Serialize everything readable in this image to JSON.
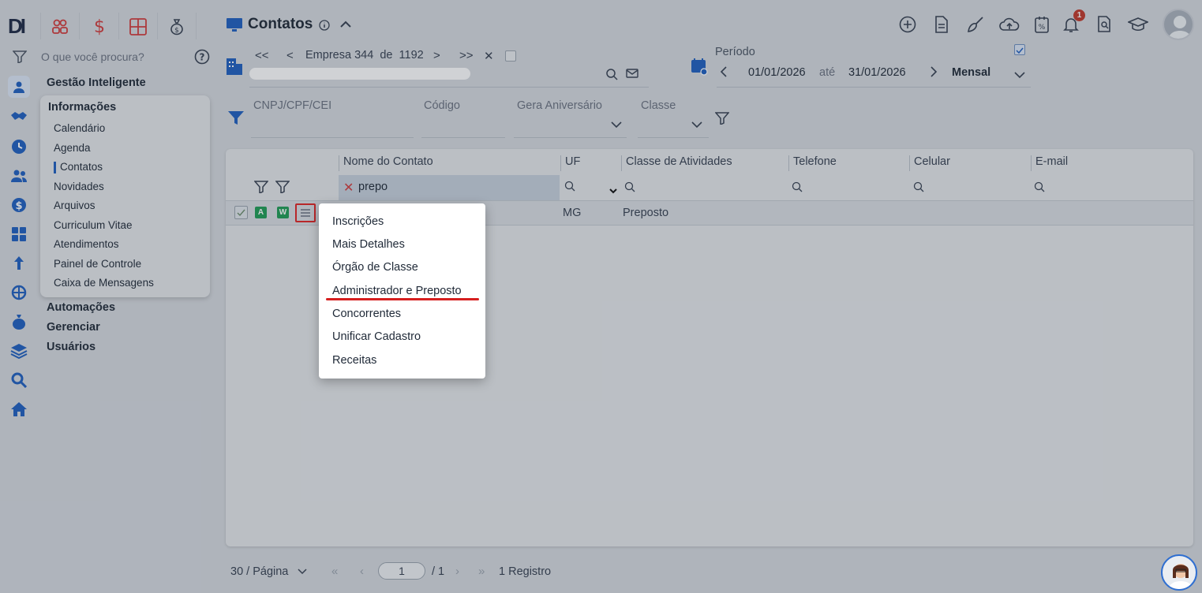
{
  "rail": {
    "logo": "DI",
    "icons": [
      "filter-icon",
      "user-card-icon",
      "handshake-icon",
      "clock-icon",
      "users-icon",
      "dollar-icon",
      "calculator-icon",
      "upload-arrow-icon",
      "globe-network-icon",
      "money-bag-icon",
      "layers-icon",
      "search-icon",
      "home-icon"
    ]
  },
  "top_modules": [
    "people-icon",
    "dollar-icon",
    "calculator-icon",
    "money-bag-icon"
  ],
  "search": {
    "placeholder": "O que você procura?"
  },
  "nav": {
    "gestao": "Gestão Inteligente",
    "informacoes": "Informações",
    "items": [
      "Calendário",
      "Agenda",
      "Contatos",
      "Novidades",
      "Arquivos",
      "Curriculum Vitae",
      "Atendimentos",
      "Painel de Controle",
      "Caixa de Mensagens"
    ],
    "automacoes": "Automações",
    "gerenciar": "Gerenciar",
    "usuarios": "Usuários"
  },
  "header": {
    "title": "Contatos",
    "icons": [
      "add-circle-icon",
      "document-icon",
      "broom-icon",
      "cloud-upload-icon",
      "percent-doc-icon",
      "bell-icon",
      "search-doc-icon",
      "graduation-cap-icon"
    ],
    "notification_count": "1"
  },
  "empresa": {
    "first": "<<",
    "prev": "<",
    "label": "Empresa",
    "current": "344",
    "de": "de",
    "total": "1192",
    "next": ">",
    "last": ">>",
    "close": "✕"
  },
  "periodo": {
    "label": "Período",
    "start": "01/01/2026",
    "ate": "até",
    "end": "31/01/2026",
    "mode": "Mensal"
  },
  "filters": {
    "cnpj": "CNPJ/CPF/CEI",
    "codigo": "Código",
    "aniversario": "Gera Aniversário",
    "classe": "Classe"
  },
  "grid": {
    "columns": [
      "Nome do Contato",
      "UF",
      "Classe de Atividades",
      "Telefone",
      "Celular",
      "E-mail"
    ],
    "name_filter": "prepo",
    "row": {
      "badge_a": "A",
      "badge_w": "W",
      "uf": "MG",
      "classe": "Preposto"
    }
  },
  "context_menu": [
    "Inscrições",
    "Mais Detalhes",
    "Órgão de Classe",
    "Administrador e Preposto",
    "Concorrentes",
    "Unificar Cadastro",
    "Receitas"
  ],
  "footer": {
    "per_page": "30 / Página",
    "page": "1",
    "total_pages": "/ 1",
    "registros": "1 Registro"
  },
  "colors": {
    "accent": "#1f5fbf",
    "danger": "#d61f1f",
    "badge_green": "#1f9d55"
  }
}
